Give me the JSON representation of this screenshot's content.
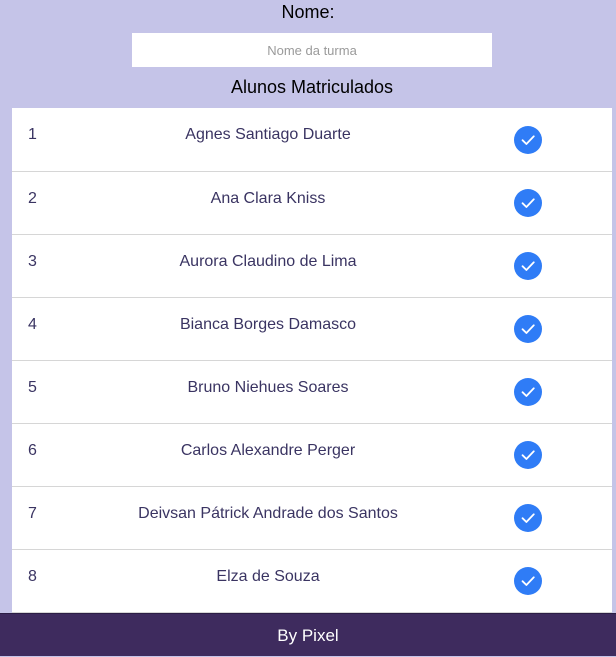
{
  "form": {
    "name_label": "Nome:",
    "name_value": "",
    "name_placeholder": "Nome da turma"
  },
  "students_section": {
    "title": "Alunos Matriculados"
  },
  "students": [
    {
      "number": "1",
      "name": "Agnes Santiago Duarte",
      "checked": true
    },
    {
      "number": "2",
      "name": "Ana Clara Kniss",
      "checked": true
    },
    {
      "number": "3",
      "name": "Aurora Claudino de Lima",
      "checked": true
    },
    {
      "number": "4",
      "name": "Bianca Borges Damasco",
      "checked": true
    },
    {
      "number": "5",
      "name": "Bruno Niehues Soares",
      "checked": true
    },
    {
      "number": "6",
      "name": "Carlos Alexandre Perger",
      "checked": true
    },
    {
      "number": "7",
      "name": "Deivsan Pátrick Andrade dos Santos",
      "checked": true
    },
    {
      "number": "8",
      "name": "Elza de Souza",
      "checked": true
    }
  ],
  "footer": {
    "text": "By Pixel"
  },
  "colors": {
    "background": "#c5c4e8",
    "footer": "#3e2b5e",
    "check_accent": "#2f7cf6",
    "row_text": "#3a3462"
  },
  "icons": {
    "row_check": "check-circle-icon"
  }
}
